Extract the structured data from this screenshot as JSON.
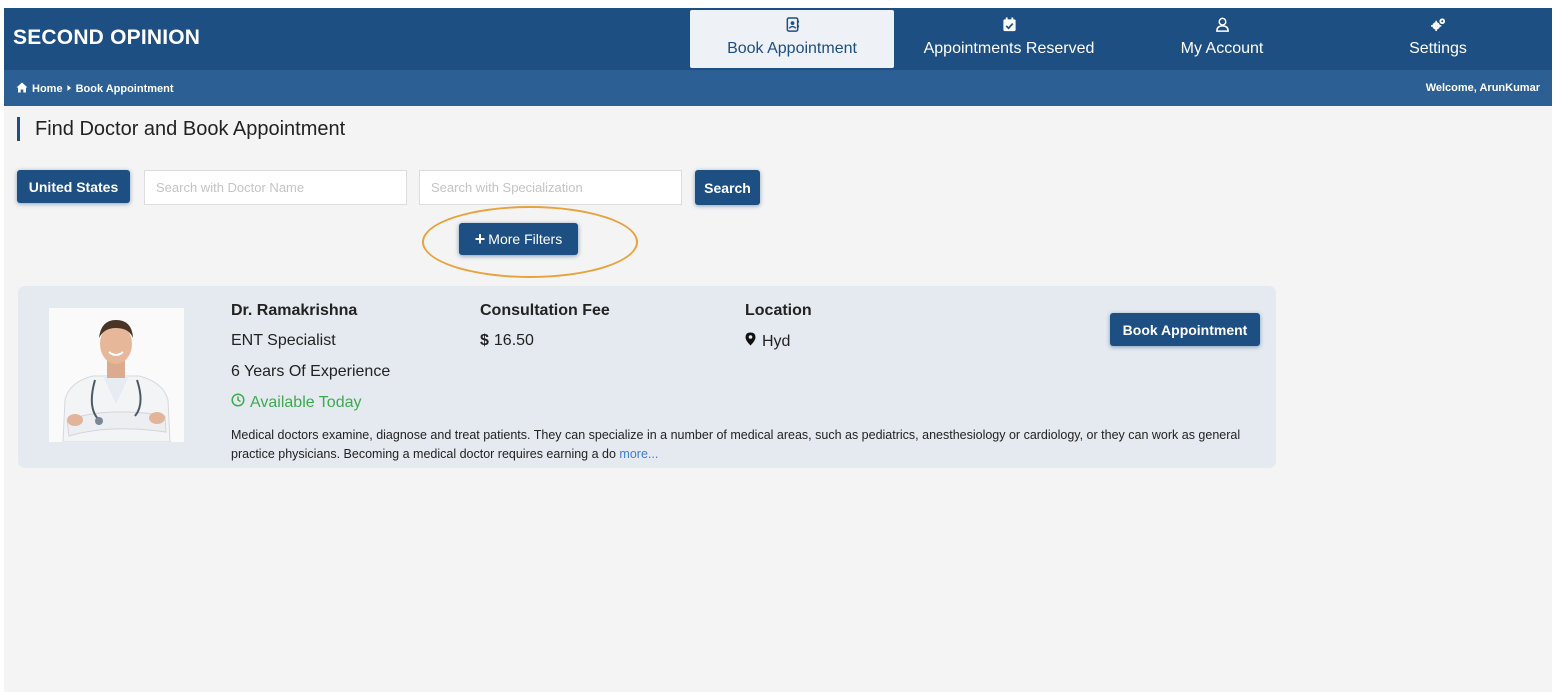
{
  "header": {
    "brand": "SECOND OPINION",
    "nav": {
      "book": {
        "label": "Book Appointment",
        "icon": "contact-book-icon"
      },
      "reserved": {
        "label": "Appointments Reserved",
        "icon": "calendar-check-icon"
      },
      "account": {
        "label": "My Account",
        "icon": "user-icon"
      },
      "settings": {
        "label": "Settings",
        "icon": "gears-icon"
      }
    },
    "active": "book"
  },
  "breadcrumb": {
    "home": "Home",
    "current": "Book Appointment",
    "welcome": "Welcome, ArunKumar"
  },
  "page": {
    "title": "Find Doctor and Book Appointment"
  },
  "search": {
    "country": "United States",
    "doctor_name_placeholder": "Search with Doctor Name",
    "doctor_name_value": "",
    "specialization_placeholder": "Search with Specialization",
    "specialization_value": "",
    "search_label": "Search",
    "more_filters_label": "More Filters"
  },
  "results": [
    {
      "name": "Dr. Ramakrishna",
      "specialty": "ENT Specialist",
      "experience": "6 Years Of Experience",
      "availability": "Available Today",
      "fee_label": "Consultation Fee",
      "currency": "$",
      "fee": "16.50",
      "location_label": "Location",
      "location": "Hyd",
      "book_label": "Book Appointment",
      "description": "Medical doctors examine, diagnose and treat patients. They can specialize in a number of medical areas, such as pediatrics, anesthesiology or cardiology, or they can work as general practice physicians. Becoming a medical doctor requires earning a do",
      "more_label": "more..."
    }
  ],
  "colors": {
    "primary": "#1d4f82",
    "subbar": "#2c5f93",
    "card_bg": "#e5eaf0",
    "available": "#3daa4f",
    "link": "#3e7bd6",
    "highlight": "#e8a23c"
  }
}
